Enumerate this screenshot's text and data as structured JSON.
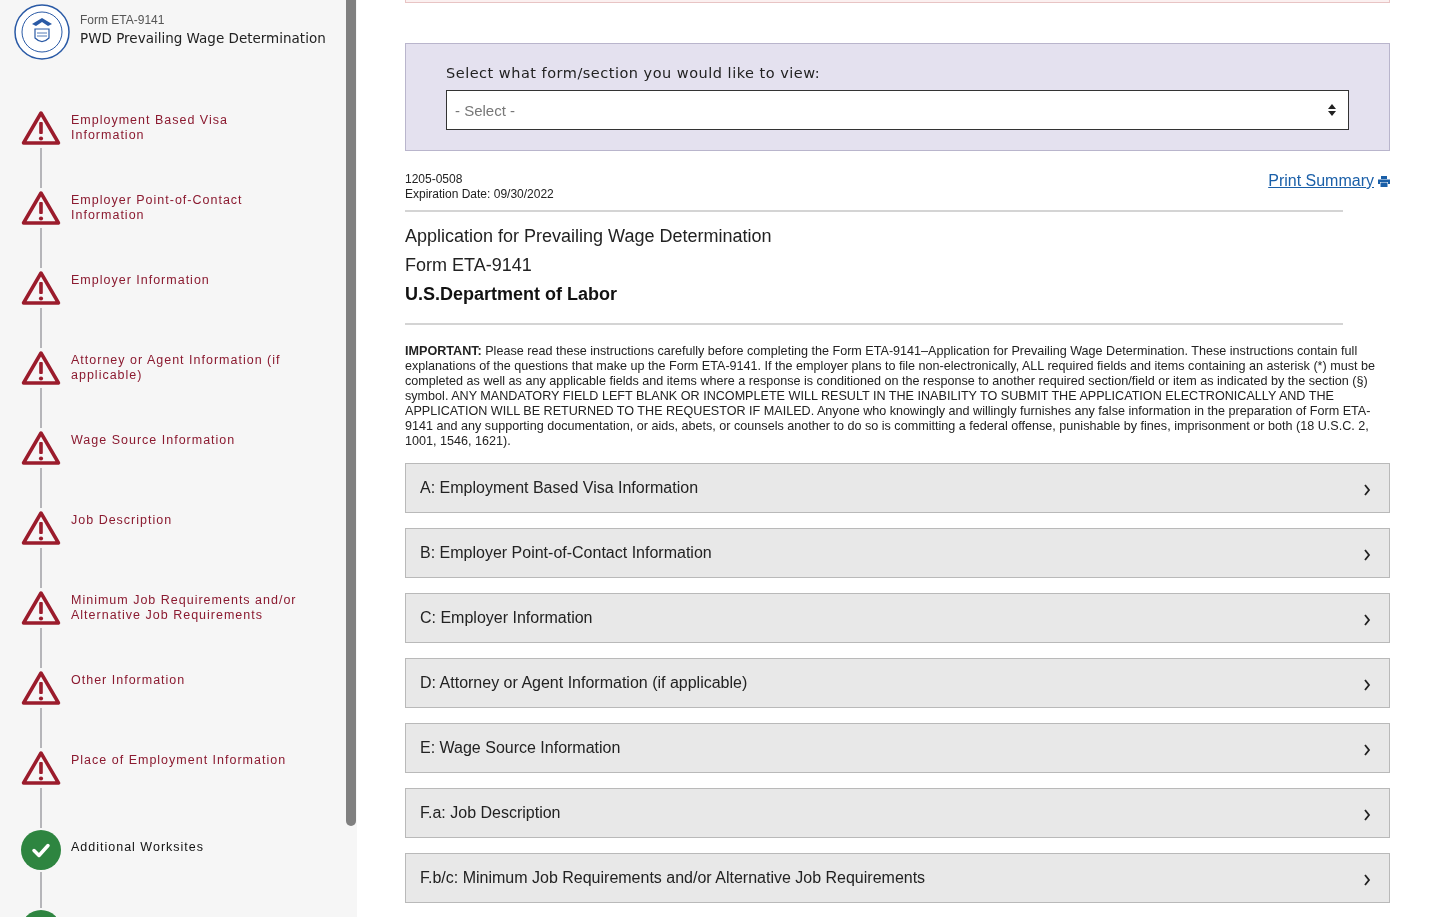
{
  "header": {
    "form_number": "Form ETA-9141",
    "title": "PWD Prevailing Wage Determination"
  },
  "steps": [
    {
      "label": "Employment Based Visa Information",
      "kind": "warning"
    },
    {
      "label": "Employer Point-of-Contact Information",
      "kind": "warning"
    },
    {
      "label": "Employer Information",
      "kind": "warning"
    },
    {
      "label": "Attorney or Agent Information (if applicable)",
      "kind": "warning"
    },
    {
      "label": "Wage Source Information",
      "kind": "warning"
    },
    {
      "label": "Job Description",
      "kind": "warning"
    },
    {
      "label": "Minimum Job Requirements and/or Alternative Job Requirements",
      "kind": "warning"
    },
    {
      "label": "Other Information",
      "kind": "warning"
    },
    {
      "label": "Place of Employment Information",
      "kind": "warning"
    },
    {
      "label": "Additional Worksites",
      "kind": "complete"
    },
    {
      "kind": "complete"
    }
  ],
  "view_select": {
    "label": "Select what form/section you would like to view:",
    "placeholder": "- Select -"
  },
  "omb": {
    "number": "1205-0508",
    "expiration": "Expiration Date: 09/30/2022"
  },
  "print_link": "Print Summary",
  "titles": [
    "Application for Prevailing Wage Determination",
    "Form ETA-9141",
    "U.S.Department of Labor"
  ],
  "important": "**IMPORTANT:** Please read these instructions carefully before completing the Form ETA-9141–Application for Prevailing Wage Determination. These instructions contain full explanations of the questions that make up the Form ETA-9141. If the employer plans to file non-electronically, ALL required fields and items containing an asterisk (*) must be completed as well as any applicable fields and items where a response is conditioned on the response to another required section/field or item as indicated by the section (§) symbol. ANY MANDATORY FIELD LEFT BLANK OR INCOMPLETE WILL RESULT IN THE INABILITY TO SUBMIT THE APPLICATION ELECTRONICALLY AND THE APPLICATION WILL BE RETURNED TO THE REQUESTOR IF MAILED. Anyone who knowingly and willingly furnishes any false information in the preparation of Form ETA-9141 and any supporting documentation, or aids, abets, or counsels another to do so is committing a federal offense, punishable by fines, imprisonment or both (18 U.S.C. 2, 1001, 1546, 1621).",
  "sections": [
    {
      "label": "A: Employment Based Visa Information",
      "expanded": false
    },
    {
      "label": "B: Employer Point-of-Contact Information",
      "expanded": false
    },
    {
      "label": "C: Employer Information",
      "expanded": false
    },
    {
      "label": "D: Attorney or Agent Information (if applicable)",
      "expanded": false
    },
    {
      "label": "E: Wage Source Information",
      "expanded": false
    },
    {
      "label": "F.a: Job Description",
      "expanded": false
    },
    {
      "label": "F.b/c: Minimum Job Requirements and/or Alternative Job Requirements",
      "expanded": false
    }
  ]
}
